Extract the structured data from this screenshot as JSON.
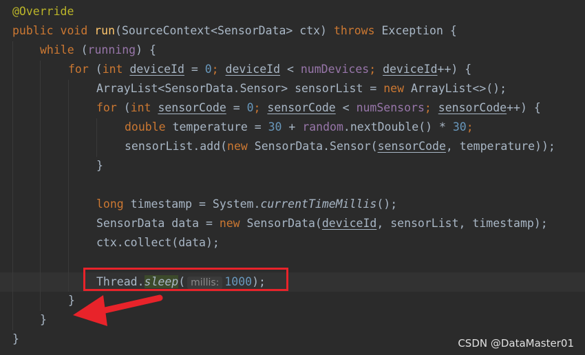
{
  "code": {
    "l1_ann": "@Override",
    "l2": {
      "public": "public",
      "void": "void",
      "run": "run",
      "sig": "(SourceContext<SensorData> ctx) ",
      "throws": "throws",
      "exc": " Exception {"
    },
    "l3": {
      "while": "while",
      "cond_open": " (",
      "running": "running",
      "cond_close": ") {"
    },
    "l4": {
      "for": "for",
      "p1": " (",
      "int": "int",
      "var1": "deviceId",
      "eq": " = ",
      "zero": "0",
      "semi1": "; ",
      "var2": "deviceId",
      "lt": " < ",
      "numDevices": "numDevices",
      "semi2": "; ",
      "var3": "deviceId",
      "end": "++) {"
    },
    "l5": {
      "decl": "ArrayList<SensorData.Sensor> sensorList = ",
      "new": "new",
      "rest": " ArrayList<>();"
    },
    "l6": {
      "for": "for",
      "p1": " (",
      "int": "int",
      "var1": "sensorCode",
      "eq": " = ",
      "zero": "0",
      "semi1": "; ",
      "var2": "sensorCode",
      "lt": " < ",
      "numSensors": "numSensors",
      "semi2": "; ",
      "var3": "sensorCode",
      "end": "++) {"
    },
    "l7": {
      "double": "double",
      "decl": " temperature = ",
      "n30a": "30",
      "plus": " + ",
      "random": "random",
      "call": ".nextDouble() * ",
      "n30b": "30",
      "semi": ";"
    },
    "l8": {
      "pre": "sensorList.add(",
      "new": "new",
      "ctor": " SensorData.Sensor(",
      "var": "sensorCode",
      "rest": ", temperature));"
    },
    "l9": "}",
    "l11": {
      "long": "long",
      "decl": " timestamp = System.",
      "method": "currentTimeMillis",
      "rest": "();"
    },
    "l12": {
      "decl": "SensorData data = ",
      "new": "new",
      "ctor": " SensorData(",
      "var": "deviceId",
      "rest": ", sensorList, timestamp);"
    },
    "l13": "ctx.collect(data);",
    "l15": {
      "cls": "Thread.",
      "method": "sleep",
      "open": "(",
      "hint": "millis:",
      "num": "1000",
      "close": ");"
    },
    "l16": "}",
    "l17": "}",
    "l18": "}"
  },
  "watermark": "CSDN @DataMaster01",
  "colors": {
    "background": "#2b2b2b",
    "keyword": "#cc7832",
    "annotation": "#bbb529",
    "number": "#6897bb",
    "field": "#9876aa",
    "highlight_box": "#e8232a",
    "arrow": "#e8232a"
  },
  "icons": {
    "arrow": "red-arrow-icon"
  }
}
